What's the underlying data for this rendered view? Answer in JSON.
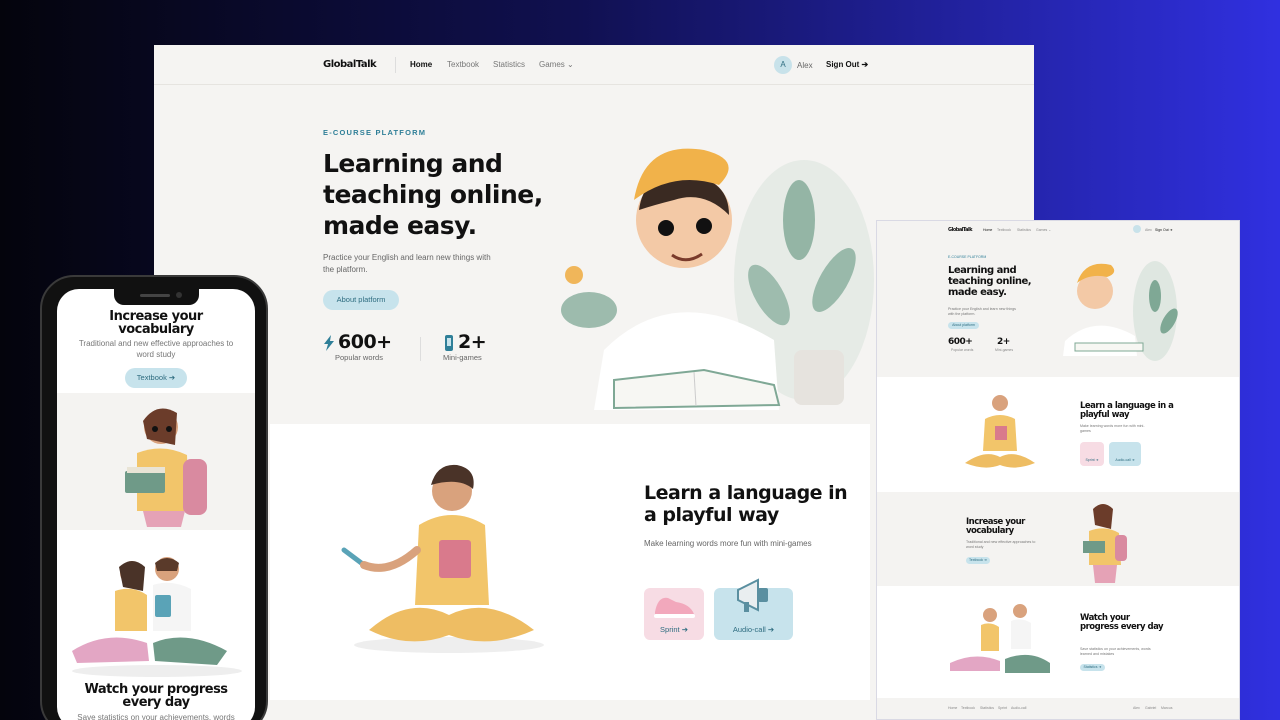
{
  "desktop": {
    "nav": {
      "logo": "GlobalTalk",
      "links": [
        {
          "label": "Home"
        },
        {
          "label": "Textbook"
        },
        {
          "label": "Statistics"
        },
        {
          "label": "Games ⌄"
        }
      ],
      "avatar_letter": "A",
      "user": "Alex",
      "signout": "Sign Out ➔"
    },
    "hero": {
      "eyebrow": "E-COURSE PLATFORM",
      "title": "Learning and teaching online, made easy.",
      "text": "Practice your English and learn new things with the platform.",
      "cta": "About platform",
      "stats": [
        {
          "value": "600+",
          "label": "Popular words",
          "icon": "lightning-icon"
        },
        {
          "value": "2+",
          "label": "Mini-games",
          "icon": "phone-icon"
        }
      ]
    },
    "games": {
      "title": "Learn a language in a playful way",
      "text": "Make learning words more fun with mini-games",
      "cards": [
        {
          "label": "Sprint ➔",
          "icon": "sneaker-icon",
          "color": "#f7dce4"
        },
        {
          "label": "Audio-call ➔",
          "icon": "megaphone-icon",
          "color": "#c7e3ec"
        }
      ]
    }
  },
  "mobile": {
    "vocab": {
      "title": "Increase your vocabulary",
      "text": "Traditional and new effective approaches to word study",
      "cta": "Textbook ➔"
    },
    "progress": {
      "title": "Watch your progress every day",
      "text": "Save statistics on your achievements, words"
    }
  },
  "tablet": {
    "nav": {
      "logo": "GlobalTalk",
      "links": [
        "Home",
        "Textbook",
        "Statistics",
        "Games ⌄"
      ],
      "user": "Alex",
      "signout": "Sign Out ➔"
    },
    "hero": {
      "eyebrow": "E-COURSE PLATFORM",
      "title": "Learning and teaching online, made easy.",
      "text": "Practice your English and learn new things with the platform.",
      "cta": "About platform",
      "stats": [
        {
          "value": "600+",
          "label": "Popular words"
        },
        {
          "value": "2+",
          "label": "Mini-games"
        }
      ]
    },
    "games": {
      "title": "Learn a language in a playful way",
      "text": "Make learning words more fun with mini-games",
      "cards": [
        "Sprint ➔",
        "Audio-call ➔"
      ]
    },
    "vocab": {
      "title": "Increase your vocabulary",
      "text": "Traditional and new effective approaches to word study",
      "cta": "Textbook ➔"
    },
    "progress": {
      "title": "Watch your progress every day",
      "text": "Save statistics on your achievements, words learned and mistakes",
      "cta": "Statistics ➔"
    },
    "footer": {
      "links": [
        "Home",
        "Textbook",
        "Statistics",
        "Sprint",
        "Audio-call"
      ],
      "people": [
        "Alex",
        "Gabriel",
        "Marcus"
      ]
    }
  },
  "colors": {
    "accent": "#2f7f98",
    "pill": "#c7e3ec",
    "pink": "#f7dce4"
  }
}
